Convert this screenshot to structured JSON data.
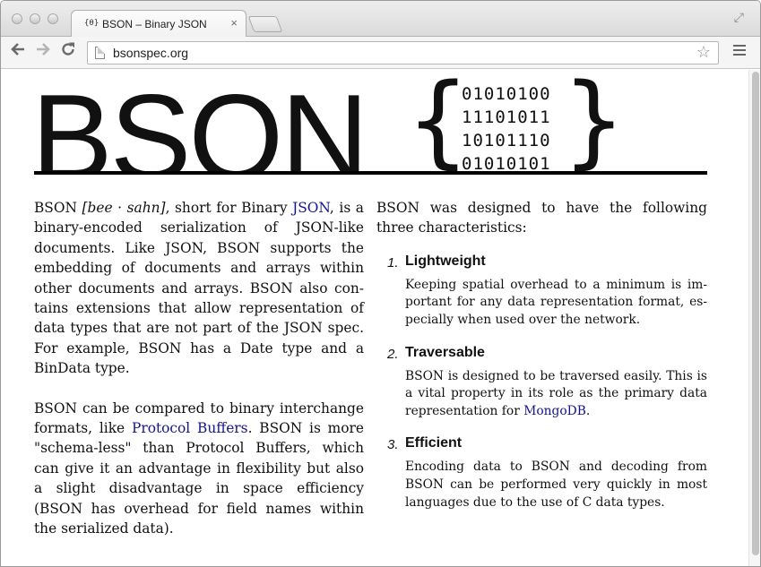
{
  "browser": {
    "tab_favicon": "{θ}",
    "tab_title": "BSON – Binary JSON",
    "tab_close": "×",
    "url": "bsonspec.org",
    "back_icon": "arrow-left",
    "forward_icon": "arrow-right",
    "reload_icon": "reload",
    "star_icon": "star",
    "menu_icon": "hamburger"
  },
  "header": {
    "title": "BSON",
    "brace_open": "{",
    "brace_close": "}",
    "bits": [
      "01010100",
      "11101011",
      "10101110",
      "01010101"
    ]
  },
  "left": {
    "p1": {
      "a": "BSON ",
      "pron": "[bee · sahn]",
      "b": ", short for Binary ",
      "link": "JSON",
      "c": ", is a binary-encoded serialization of JSON-like documents. Like JSON, BSON supports the embedding of documents and arrays within other documents and arrays. BSON also con­tains extensions that allow representation of data types that are not part of the JSON spec. For example, BSON has a Date type and a BinData type."
    },
    "p2": {
      "a": "BSON can be compared to binary interchange formats, like ",
      "link": "Protocol Buffers",
      "b": ". BSON is more \"schema-less\" than Protocol Buffers, which can give it an advantage in flexibility but also a slight disadvantage in space efficiency (BSON has overhead for field names within the serial­ized data)."
    }
  },
  "right": {
    "intro": "BSON was designed to have the following three characteristics:",
    "features": [
      {
        "num": "1.",
        "title": "Lightweight",
        "desc": "Keeping spatial overhead to a minimum is im­portant for any data representation format, es­pecially when used over the network."
      },
      {
        "num": "2.",
        "title": "Traversable",
        "desc_a": "BSON is designed to be traversed easily. This is a vital property in its role as the primary data representation for ",
        "desc_link": "MongoDB",
        "desc_b": "."
      },
      {
        "num": "3.",
        "title": "Efficient",
        "desc": "Encoding data to BSON and decoding from BSON can be performed very quickly in most languages due to the use of C data types."
      }
    ]
  }
}
